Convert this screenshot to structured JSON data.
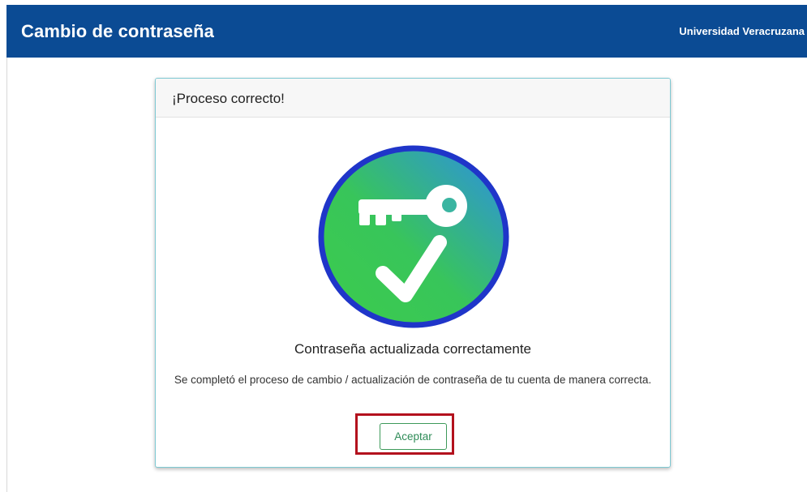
{
  "header": {
    "title": "Cambio de contraseña",
    "organization": "Universidad Veracruzana"
  },
  "dialog": {
    "title": "¡Proceso correcto!",
    "emblem_icon": "key-checkmark-icon",
    "message_title": "Contraseña actualizada correctamente",
    "message_body": "Se completó el proceso de cambio / actualización de contraseña de tu cuenta de manera correcta.",
    "accept_label": "Aceptar"
  },
  "colors": {
    "header_bg": "#0b4b94",
    "card_border": "#7ec9d3",
    "emblem_ring": "#1f35c9",
    "emblem_green": "#3ccc4c",
    "emblem_blue": "#2d8ee6",
    "button_accent": "#3e9a5a",
    "highlight": "#b3111d"
  }
}
